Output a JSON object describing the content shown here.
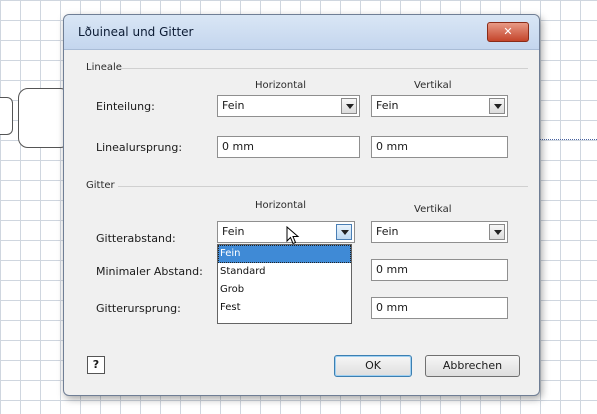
{
  "dialog": {
    "title": "Lðuineal und Gitter",
    "close_glyph": "✕"
  },
  "lineale": {
    "group_label": "Lineale",
    "col_horizontal": "Horizontal",
    "col_vertical": "Vertikal",
    "einteilung_label": "Einteilung:",
    "einteilung_h": "Fein",
    "einteilung_v": "Fein",
    "ursprung_label": "Linealursprung:",
    "ursprung_h": "0 mm",
    "ursprung_v": "0 mm"
  },
  "gitter": {
    "group_label": "Gitter",
    "col_horizontal": "Horizontal",
    "col_vertical": "Vertikal",
    "abstand_label": "Gitterabstand:",
    "abstand_h": "Fein",
    "abstand_v": "Fein",
    "min_label": "Minimaler Abstand:",
    "min_v": "0 mm",
    "ursprung_label": "Gitterursprung:",
    "ursprung_v": "0 mm"
  },
  "dropdown": {
    "options": [
      "Fein",
      "Standard",
      "Grob",
      "Fest"
    ],
    "selected": "Fein"
  },
  "buttons": {
    "help": "?",
    "ok": "OK",
    "cancel": "Abbrechen"
  },
  "colors": {
    "highlight": "#3f8ad6",
    "close_button": "#c4452b",
    "titlebar": "#c4d6ee"
  }
}
